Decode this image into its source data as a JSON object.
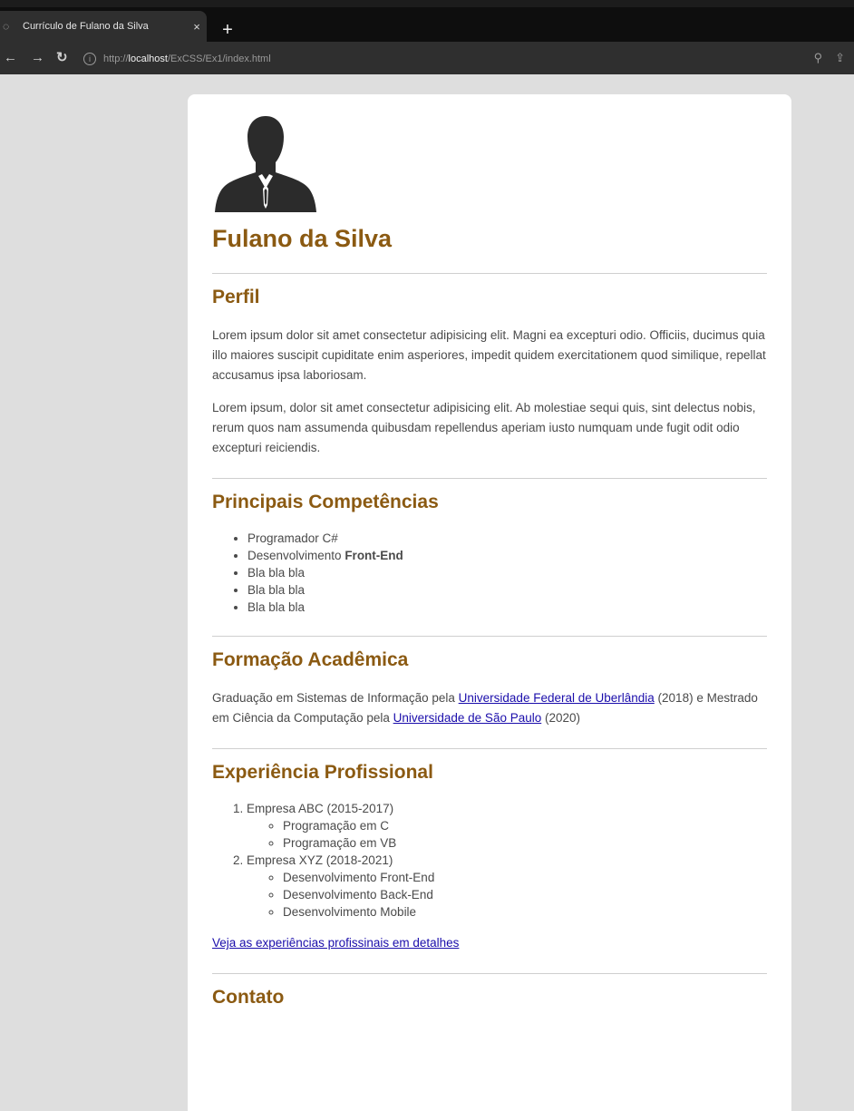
{
  "browser": {
    "tab_title": "Currículo de Fulano da Silva",
    "tab_close": "×",
    "new_tab": "+",
    "url_scheme": "http://",
    "url_host": "localhost",
    "url_path": "/ExCSS/Ex1/index.html"
  },
  "resume": {
    "name": "Fulano da Silva",
    "perfil": {
      "heading": "Perfil",
      "p1": "Lorem ipsum dolor sit amet consectetur adipisicing elit. Magni ea excepturi odio. Officiis, ducimus quia illo maiores suscipit cupiditate enim asperiores, impedit quidem exercitationem quod similique, repellat accusamus ipsa laboriosam.",
      "p2": "Lorem ipsum, dolor sit amet consectetur adipisicing elit. Ab molestiae sequi quis, sint delectus nobis, rerum quos nam assumenda quibusdam repellendus aperiam iusto numquam unde fugit odit odio excepturi reiciendis."
    },
    "competencias": {
      "heading": "Principais Competências",
      "items": [
        "Programador C#",
        "Desenvolvimento ",
        "Bla bla bla",
        "Bla bla bla",
        "Bla bla bla"
      ],
      "bold_suffix": "Front-End"
    },
    "formacao": {
      "heading": "Formação Acadêmica",
      "t1": "Graduação em Sistemas de Informação pela ",
      "link1": "Universidade Federal de Uberlândia",
      "t2": " (2018) e Mestrado em Ciência da Computação pela ",
      "link2": "Universidade de São Paulo",
      "t3": " (2020)"
    },
    "experiencia": {
      "heading": "Experiência Profissional",
      "jobs": [
        {
          "label": "Empresa ABC (2015-2017)",
          "items": [
            "Programação em C",
            "Programação em VB"
          ]
        },
        {
          "label": "Empresa XYZ (2018-2021)",
          "items": [
            "Desenvolvimento Front-End",
            "Desenvolvimento Back-End",
            "Desenvolvimento Mobile"
          ]
        }
      ],
      "details_link": "Veja as experiências profissinais em detalhes"
    },
    "contato": {
      "heading": "Contato"
    }
  },
  "colors": {
    "heading": "#8b5a12",
    "link": "#1a0dab",
    "page_bg": "#dedede"
  },
  "icons": [
    "page-favicon",
    "back-arrow-icon",
    "forward-arrow-icon",
    "reload-icon",
    "info-icon",
    "zoom-icon",
    "share-icon",
    "person-silhouette-icon"
  ]
}
